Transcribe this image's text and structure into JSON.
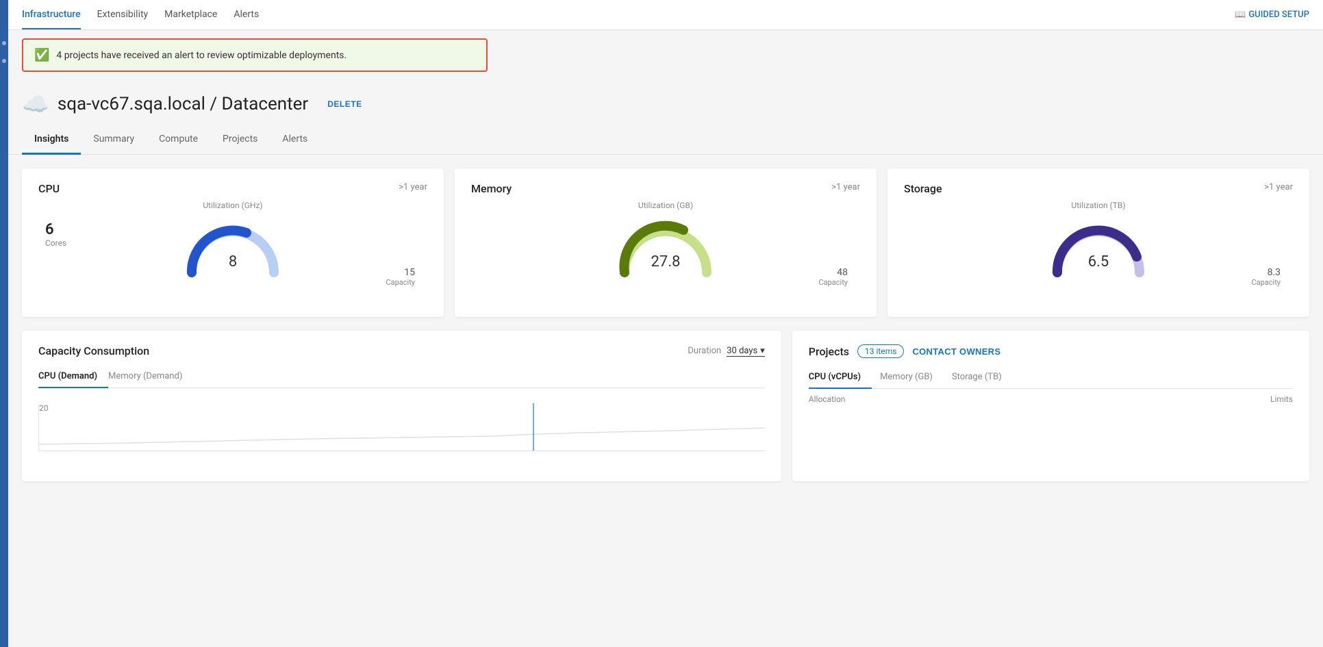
{
  "topNav": {
    "items": [
      {
        "label": "Infrastructure",
        "active": true
      },
      {
        "label": "Extensibility",
        "active": false
      },
      {
        "label": "Marketplace",
        "active": false
      },
      {
        "label": "Alerts",
        "active": false
      }
    ],
    "guidedSetup": "GUIDED SETUP"
  },
  "alert": {
    "text": "4 projects have received an alert to review optimizable deployments."
  },
  "pageHeader": {
    "title": "sqa-vc67.sqa.local / Datacenter",
    "deleteButton": "DELETE"
  },
  "tabs": [
    {
      "label": "Insights",
      "active": true
    },
    {
      "label": "Summary",
      "active": false
    },
    {
      "label": "Compute",
      "active": false
    },
    {
      "label": "Projects",
      "active": false
    },
    {
      "label": "Alerts",
      "active": false
    }
  ],
  "metrics": {
    "cpu": {
      "title": "CPU",
      "timeLabel": ">1 year",
      "coresValue": "6",
      "coresLabel": "Cores",
      "utilizationLabel": "Utilization (GHz)",
      "currentValue": "8",
      "capacityValue": "15",
      "capacityLabel": "Capacity",
      "gaugeUsedColor": "#2255cc",
      "gaugeTrackColor": "#b8cef5"
    },
    "memory": {
      "title": "Memory",
      "timeLabel": ">1 year",
      "utilizationLabel": "Utilization (GB)",
      "currentValue": "27.8",
      "capacityValue": "48",
      "capacityLabel": "Capacity",
      "gaugeUsedColor": "#5a7a0a",
      "gaugeTrackColor": "#c8df8a"
    },
    "storage": {
      "title": "Storage",
      "timeLabel": ">1 year",
      "utilizationLabel": "Utilization (TB)",
      "currentValue": "6.5",
      "capacityValue": "8.3",
      "capacityLabel": "Capacity",
      "gaugeUsedColor": "#3d2d8a",
      "gaugeTrackColor": "#c5c0e8"
    }
  },
  "capacityConsumption": {
    "title": "Capacity Consumption",
    "durationLabel": "Duration",
    "durationValue": "30 days",
    "subTabs": [
      {
        "label": "CPU (Demand)",
        "active": true
      },
      {
        "label": "Memory (Demand)",
        "active": false
      }
    ],
    "chartYLabel": "20"
  },
  "projects": {
    "title": "Projects",
    "itemsCount": "13 items",
    "contactOwners": "CONTACT OWNERS",
    "subTabs": [
      {
        "label": "CPU (vCPUs)",
        "active": true
      },
      {
        "label": "Memory (GB)",
        "active": false
      },
      {
        "label": "Storage (TB)",
        "active": false
      }
    ],
    "colHeaders": [
      "Allocation",
      "Limits"
    ]
  }
}
